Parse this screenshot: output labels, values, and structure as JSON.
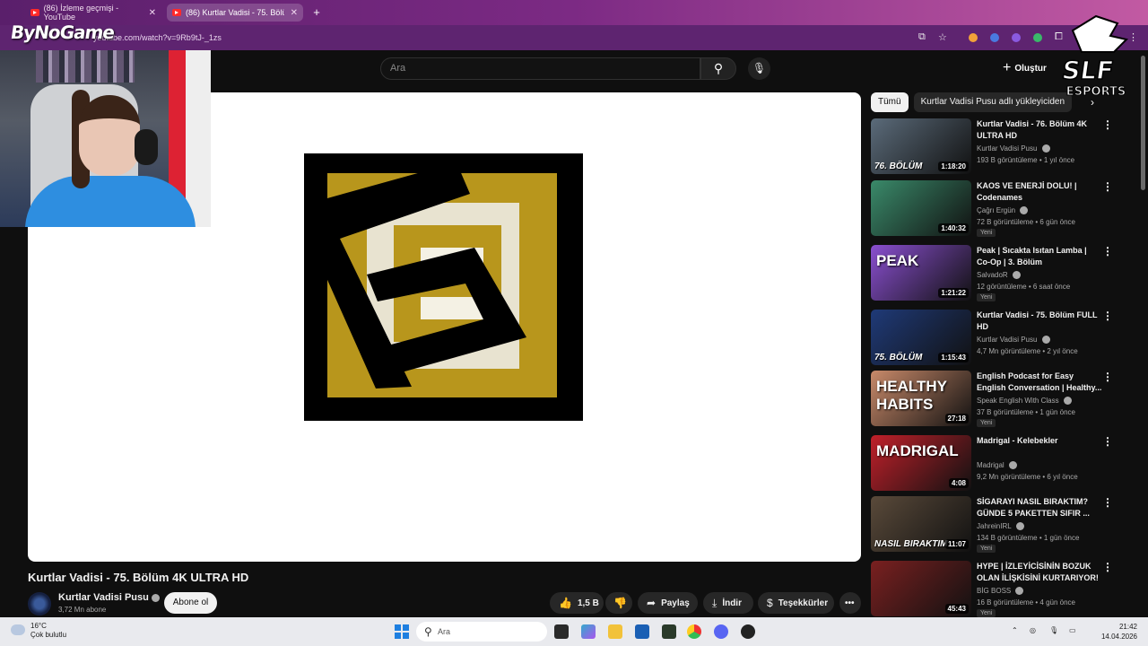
{
  "browser": {
    "tabs": [
      {
        "label": "(86) İzleme geçmişi - YouTube",
        "active": false
      },
      {
        "label": "(86) Kurtlar Vadisi - 75. Bölüm 4",
        "active": true
      }
    ],
    "url": "youtube.com/watch?v=9Rb9tJ-_1zs",
    "overlay_logo": "ByNoGame"
  },
  "youtube": {
    "search_placeholder": "Ara",
    "create_label": "Oluştur"
  },
  "video": {
    "title": "Kurtlar Vadisi - 75. Bölüm 4K ULTRA HD",
    "channel": "Kurtlar Vadisi Pusu",
    "subscribers": "3,72 Mn abone",
    "subscribe_label": "Abone ol",
    "likes": "1,5 B",
    "share_label": "Paylaş",
    "download_label": "İndir",
    "thanks_label": "Teşekkürler"
  },
  "sidebar": {
    "chips": [
      {
        "label": "Tümü",
        "selected": true
      },
      {
        "label": "Kurtlar Vadisi Pusu adlı yükleyiciden",
        "selected": false
      }
    ],
    "items": [
      {
        "title": "Kurtlar Vadisi - 76. Bölüm 4K ULTRA HD",
        "channel": "Kurtlar Vadisi Pusu",
        "meta": "193 B görüntüleme • 1 yıl önce",
        "duration": "1:18:20",
        "thumb_text": "76. BÖLÜM",
        "badge": "",
        "color": "#5b6b7a"
      },
      {
        "title": "KAOS VE ENERJİ DOLU! | Codenames",
        "channel": "Çağrı Ergün",
        "meta": "72 B görüntüleme • 6 gün önce",
        "duration": "1:40:32",
        "thumb_text": "",
        "badge": "Yeni",
        "color": "#3a8a6a"
      },
      {
        "title": "Peak | Sıcakta Isıtan Lamba | Co-Op | 3. Bölüm",
        "channel": "SalvadoR",
        "meta": "12 görüntüleme • 6 saat önce",
        "duration": "1:21:22",
        "thumb_text": "PEAK",
        "badge": "Yeni",
        "color": "#8a4fd0"
      },
      {
        "title": "Kurtlar Vadisi - 75. Bölüm FULL HD",
        "channel": "Kurtlar Vadisi Pusu",
        "meta": "4,7 Mn görüntüleme • 2 yıl önce",
        "duration": "1:15:43",
        "thumb_text": "75. BÖLÜM",
        "badge": "",
        "color": "#1f3a78"
      },
      {
        "title": "English Podcast for Easy English Conversation | Healthy...",
        "channel": "Speak English With Class",
        "meta": "37 B görüntüleme • 1 gün önce",
        "duration": "27:18",
        "thumb_text": "HEALTHY HABITS",
        "badge": "Yeni",
        "color": "#c98a6a"
      },
      {
        "title": "Madrigal - Kelebekler",
        "channel": "Madrigal",
        "meta": "9,2 Mn görüntüleme • 6 yıl önce",
        "duration": "4:08",
        "thumb_text": "MADRIGAL",
        "badge": "",
        "color": "#c0202a"
      },
      {
        "title": "SİGARAYI NASIL BIRAKTIM? GÜNDE 5 PAKETTEN SIFIR ...",
        "channel": "JahreinIRL",
        "meta": "134 B görüntüleme • 1 gün önce",
        "duration": "11:07",
        "thumb_text": "NASIL BIRAKTIM",
        "badge": "Yeni",
        "color": "#5a4a3a"
      },
      {
        "title": "HYPE | İZLEYİCİSİNİN BOZUK OLAN İLİŞKİSİNİ KURTARIYOR!",
        "channel": "BİG BOSS",
        "meta": "16 B görüntüleme • 4 gün önce",
        "duration": "45:43",
        "thumb_text": "",
        "badge": "Yeni",
        "color": "#7a2020"
      }
    ]
  },
  "taskbar": {
    "temperature": "16°C",
    "weather": "Çok bulutlu",
    "search_placeholder": "Ara",
    "time": "21:42",
    "date": "14.04.2026"
  },
  "brand": {
    "slf_line1": "SLF",
    "slf_line2": "ESPORTS"
  }
}
